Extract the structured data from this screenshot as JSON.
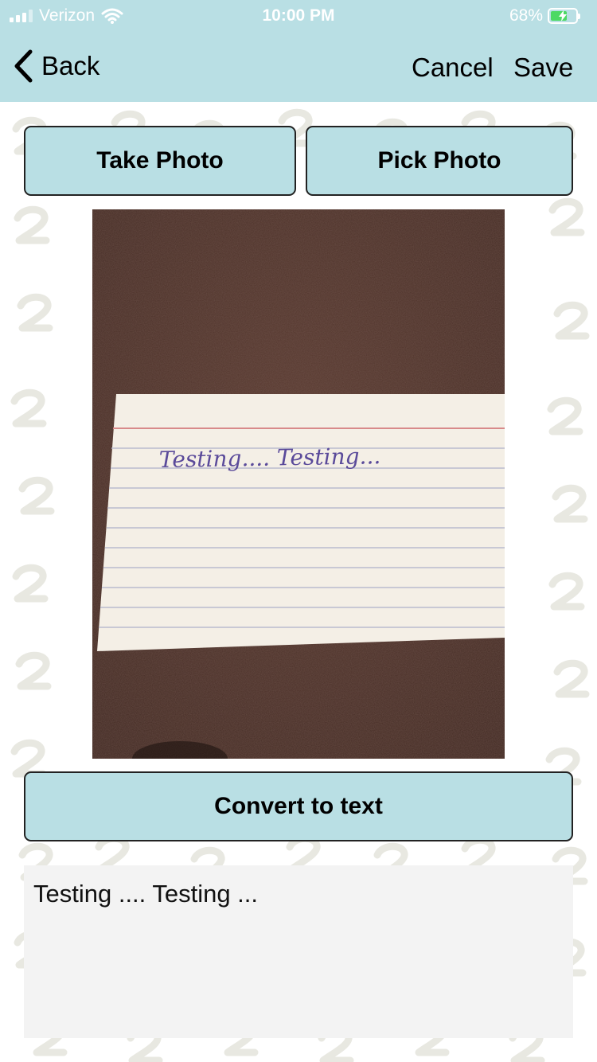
{
  "status_bar": {
    "carrier": "Verizon",
    "time": "10:00 PM",
    "battery_percent": "68%",
    "battery_level": 0.68,
    "charging": true
  },
  "nav": {
    "back_label": "Back",
    "cancel_label": "Cancel",
    "save_label": "Save"
  },
  "buttons": {
    "take_photo": "Take Photo",
    "pick_photo": "Pick Photo",
    "convert": "Convert to text"
  },
  "photo": {
    "handwriting": "Testing.... Testing..."
  },
  "result": {
    "text": "Testing .... Testing ..."
  },
  "colors": {
    "accent": "#b9dfe4",
    "card": "#f4efe6",
    "table": "#4a3028",
    "ink": "#5a4a9a"
  }
}
